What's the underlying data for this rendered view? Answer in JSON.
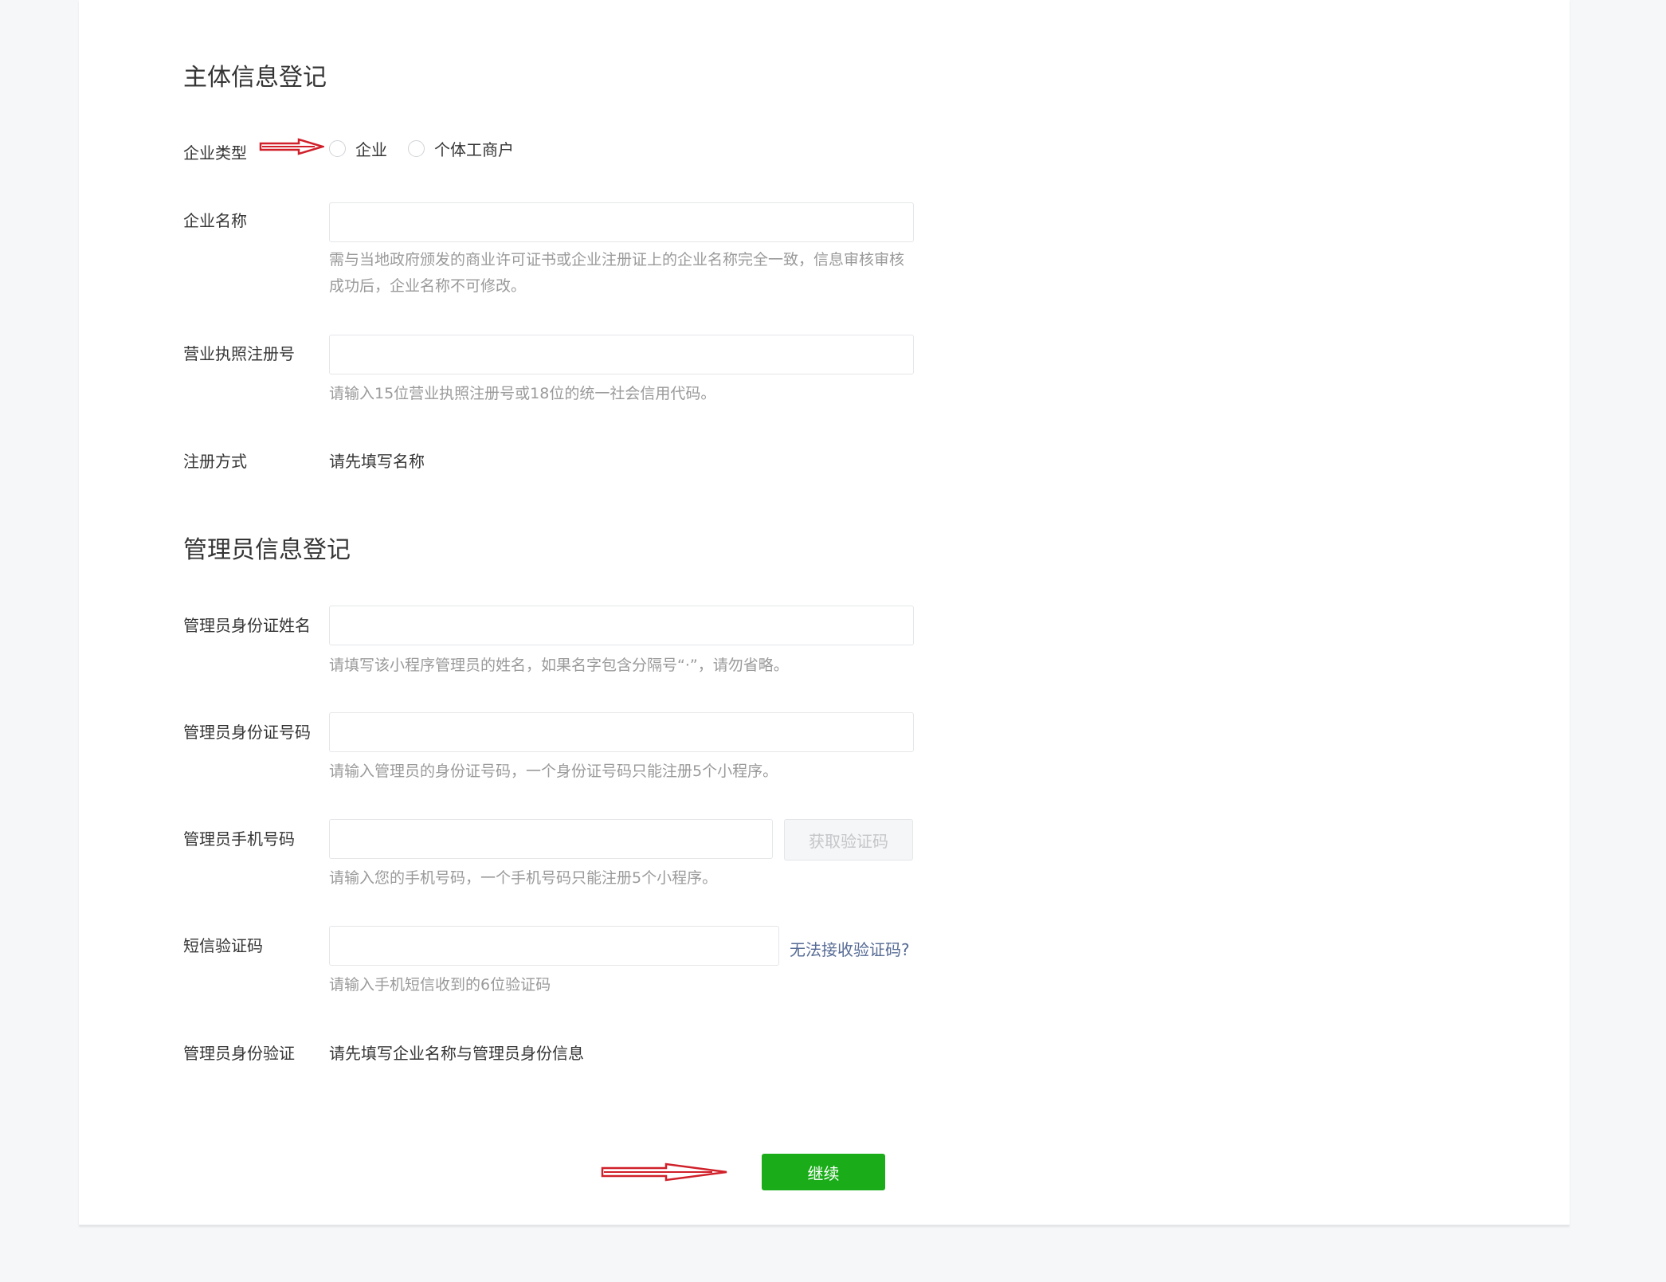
{
  "section1": {
    "title": "主体信息登记",
    "company_type": {
      "label": "企业类型",
      "options": [
        "企业",
        "个体工商户"
      ]
    },
    "company_name": {
      "label": "企业名称",
      "value": "",
      "tip": "需与当地政府颁发的商业许可证书或企业注册证上的企业名称完全一致，信息审核审核成功后，企业名称不可修改。"
    },
    "license_no": {
      "label": "营业执照注册号",
      "value": "",
      "tip": "请输入15位营业执照注册号或18位的统一社会信用代码。"
    },
    "reg_method": {
      "label": "注册方式",
      "value": "请先填写名称"
    }
  },
  "section2": {
    "title": "管理员信息登记",
    "admin_name": {
      "label": "管理员身份证姓名",
      "value": "",
      "tip": "请填写该小程序管理员的姓名，如果名字包含分隔号“·”，请勿省略。"
    },
    "admin_id": {
      "label": "管理员身份证号码",
      "value": "",
      "tip": "请输入管理员的身份证号码，一个身份证号码只能注册5个小程序。"
    },
    "admin_phone": {
      "label": "管理员手机号码",
      "value": "",
      "get_code_label": "获取验证码",
      "tip": "请输入您的手机号码，一个手机号码只能注册5个小程序。"
    },
    "sms_code": {
      "label": "短信验证码",
      "value": "",
      "help_link": "无法接收验证码?",
      "tip": "请输入手机短信收到的6位验证码"
    },
    "admin_verify": {
      "label": "管理员身份验证",
      "value": "请先填写企业名称与管理员身份信息"
    }
  },
  "actions": {
    "continue_label": "继续"
  },
  "colors": {
    "primary_button": "#1aad19",
    "link": "#576b95",
    "annotation_arrow": "#d0202a"
  },
  "icons": [
    "radio-unchecked-icon",
    "annotation-arrow-icon"
  ]
}
